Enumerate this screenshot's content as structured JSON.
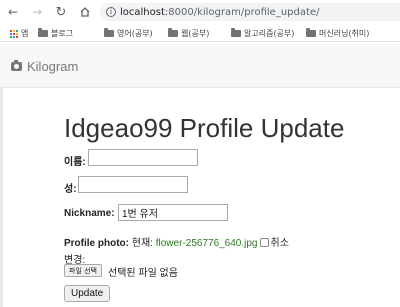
{
  "browser": {
    "url_host": "localhost",
    "url_path": ":8000/kilogram/profile_update/",
    "bookmarks": [
      {
        "label": "앱",
        "icon": "apps-icon"
      },
      {
        "label": "블로그",
        "icon": "folder-icon"
      },
      {
        "label": "영어(공부)",
        "icon": "folder-icon"
      },
      {
        "label": "웹(공부)",
        "icon": "folder-icon"
      },
      {
        "label": "알고리즘(공부)",
        "icon": "folder-icon"
      },
      {
        "label": "머신러닝(취미)",
        "icon": "folder-icon"
      }
    ],
    "app_colors": [
      "#ea4335",
      "#fbbc05",
      "#34a853",
      "#4285f4",
      "#ea4335",
      "#fbbc05",
      "#34a853",
      "#4285f4",
      "#ea4335"
    ]
  },
  "navbar": {
    "brand": "Kilogram",
    "brand_icon": "camera-icon"
  },
  "form": {
    "title": "Idgeao99 Profile Update",
    "last_name_label": "이름:",
    "last_name_value": "",
    "first_name_label": "성:",
    "first_name_value": "",
    "nickname_label": "Nickname:",
    "nickname_value": "1번 유저",
    "photo_label": "Profile photo:",
    "current_label": "현재:",
    "current_file": "flower-256776_640.jpg",
    "clear_label": "취소",
    "change_label": "변경:",
    "file_button": "파일 선택",
    "no_file_text": "선택된 파일 없음",
    "submit_label": "Update"
  }
}
